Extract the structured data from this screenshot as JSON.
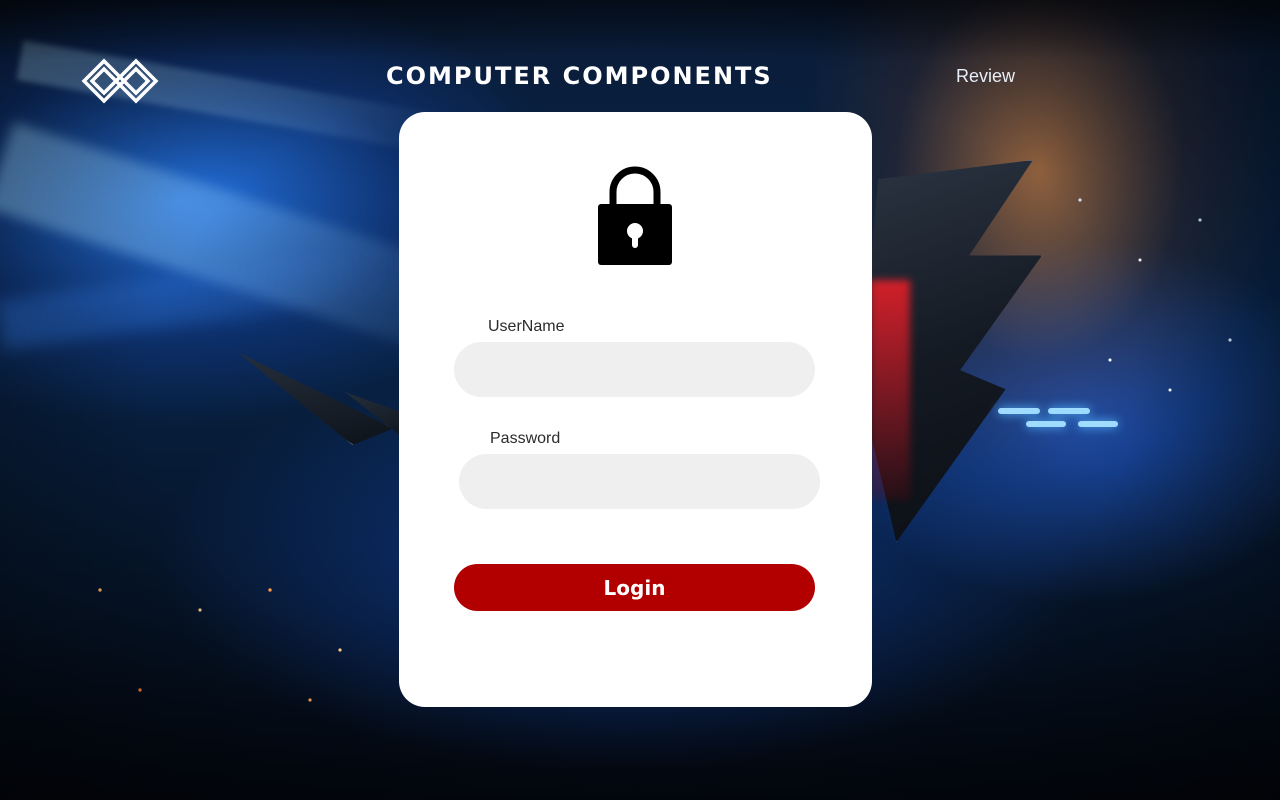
{
  "header": {
    "brand_title": "COMPUTER COMPONENTS",
    "nav_review": "Review",
    "logo_icon": "interlocking-diamonds-logo"
  },
  "login_card": {
    "icon": "lock-icon",
    "username_label": "UserName",
    "username_value": "",
    "password_label": "Password",
    "password_value": "",
    "login_button": "Login"
  },
  "colors": {
    "accent": "#b20000",
    "input_background": "#efefef",
    "card_background": "#ffffff",
    "header_text": "#ffffff"
  }
}
